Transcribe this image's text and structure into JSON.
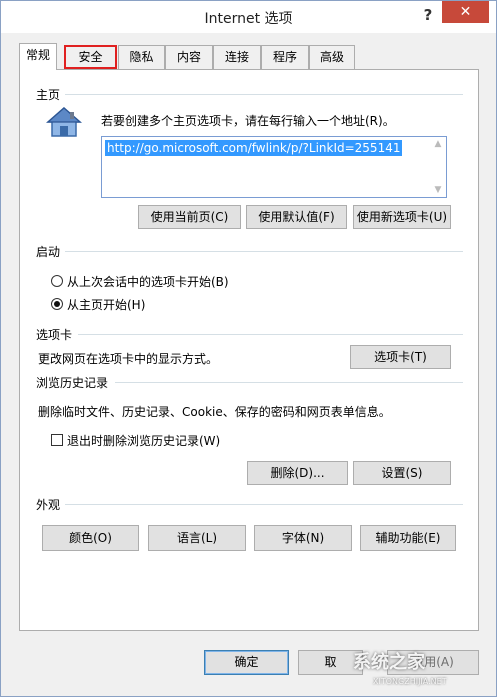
{
  "window": {
    "title": "Internet 选项",
    "help": "?",
    "close": "✕"
  },
  "tabs": [
    {
      "label": "常规",
      "active": true
    },
    {
      "label": "安全",
      "highlighted": true
    },
    {
      "label": "隐私"
    },
    {
      "label": "内容"
    },
    {
      "label": "连接"
    },
    {
      "label": "程序"
    },
    {
      "label": "高级"
    }
  ],
  "homepage": {
    "section": "主页",
    "instruction": "若要创建多个主页选项卡，请在每行输入一个地址(R)。",
    "url": "http://go.microsoft.com/fwlink/p/?LinkId=255141",
    "buttons": [
      "使用当前页(C)",
      "使用默认值(F)",
      "使用新选项卡(U)"
    ],
    "icon": "house-icon"
  },
  "startup": {
    "section": "启动",
    "options": [
      {
        "label": "从上次会话中的选项卡开始(B)",
        "checked": false
      },
      {
        "label": "从主页开始(H)",
        "checked": true
      }
    ]
  },
  "tabs_section": {
    "section": "选项卡",
    "description": "更改网页在选项卡中的显示方式。",
    "button": "选项卡(T)"
  },
  "history": {
    "section": "浏览历史记录",
    "description": "删除临时文件、历史记录、Cookie、保存的密码和网页表单信息。",
    "checkbox": {
      "label": "退出时删除浏览历史记录(W)",
      "checked": false
    },
    "delete_button": "删除(D)...",
    "settings_button": "设置(S)"
  },
  "appearance": {
    "section": "外观",
    "buttons": [
      "颜色(O)",
      "语言(L)",
      "字体(N)",
      "辅助功能(E)"
    ]
  },
  "footer": {
    "ok": "确定",
    "cancel": "取",
    "apply": "应用(A)"
  },
  "watermark": {
    "main": "系统之家",
    "sub": "XITONGZHIJIA.NET"
  }
}
